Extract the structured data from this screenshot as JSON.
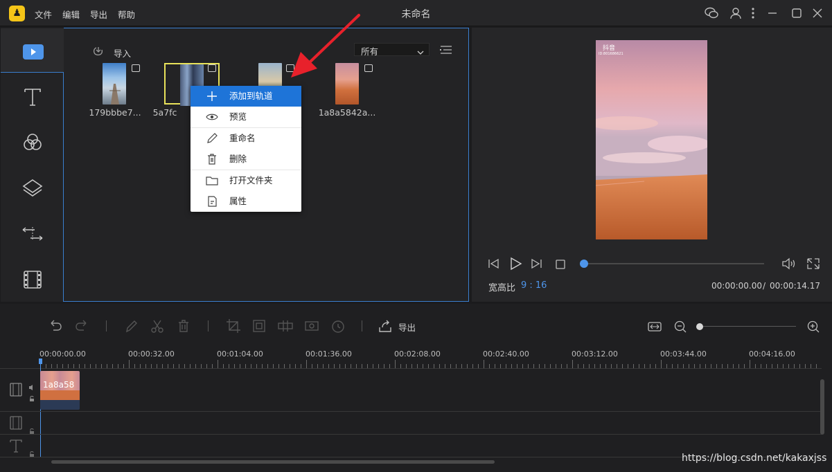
{
  "app": {
    "title": "未命名",
    "menu": [
      "文件",
      "编辑",
      "导出",
      "帮助"
    ]
  },
  "media": {
    "import_label": "导入",
    "filter": {
      "selected": "所有"
    },
    "items": [
      {
        "name": "179bbbe7...",
        "thumb": "pier"
      },
      {
        "name": "5a7fc",
        "thumb": "curtain"
      },
      {
        "name": "",
        "thumb": "sunset"
      },
      {
        "name": "1a8a5842a...",
        "thumb": "beach"
      }
    ]
  },
  "context_menu": {
    "items": [
      {
        "label": "添加到轨道",
        "icon": "plus-icon"
      },
      {
        "label": "预览",
        "icon": "eye-icon"
      },
      {
        "label": "重命名",
        "icon": "pencil-icon"
      },
      {
        "label": "删除",
        "icon": "trash-icon"
      },
      {
        "label": "打开文件夹",
        "icon": "folder-icon"
      },
      {
        "label": "属性",
        "icon": "properties-icon"
      }
    ]
  },
  "preview": {
    "watermark_brand": "抖音",
    "watermark_id": "ID:801686621",
    "aspect_label": "宽高比",
    "aspect_value": "9 : 16",
    "time_current": "00:00:00.00",
    "time_total": "00:00:14.17",
    "time_separator": "/",
    "progress": 0
  },
  "timeline": {
    "export_label": "导出",
    "timestamps": [
      "00:00:00.00",
      "00:00:32.00",
      "00:01:04.00",
      "00:01:36.00",
      "00:02:08.00",
      "00:02:40.00",
      "00:03:12.00",
      "00:03:44.00",
      "00:04:16.00"
    ],
    "clip_label": "1a8a58"
  },
  "watermark": "https://blog.csdn.net/kakaxjss",
  "colors": {
    "accent": "#3a7fd0",
    "highlight": "#1e74d8",
    "selection_border": "#e9e35a",
    "arrow": "#e8212b"
  }
}
